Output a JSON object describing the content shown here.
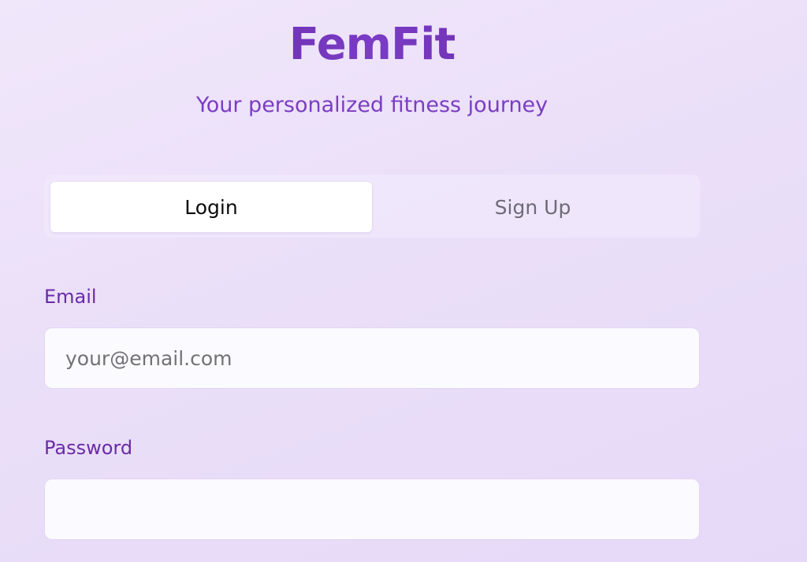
{
  "header": {
    "title": "FemFit",
    "subtitle": "Your personalized fitness journey"
  },
  "tabs": [
    {
      "label": "Login",
      "active": true
    },
    {
      "label": "Sign Up",
      "active": false
    }
  ],
  "form": {
    "email": {
      "label": "Email",
      "placeholder": "your@email.com",
      "value": ""
    },
    "password": {
      "label": "Password",
      "placeholder": "",
      "value": ""
    }
  },
  "colors": {
    "brand": "#6b2fb0",
    "accent": "#7b3dc4",
    "background": "#ece1fa"
  }
}
